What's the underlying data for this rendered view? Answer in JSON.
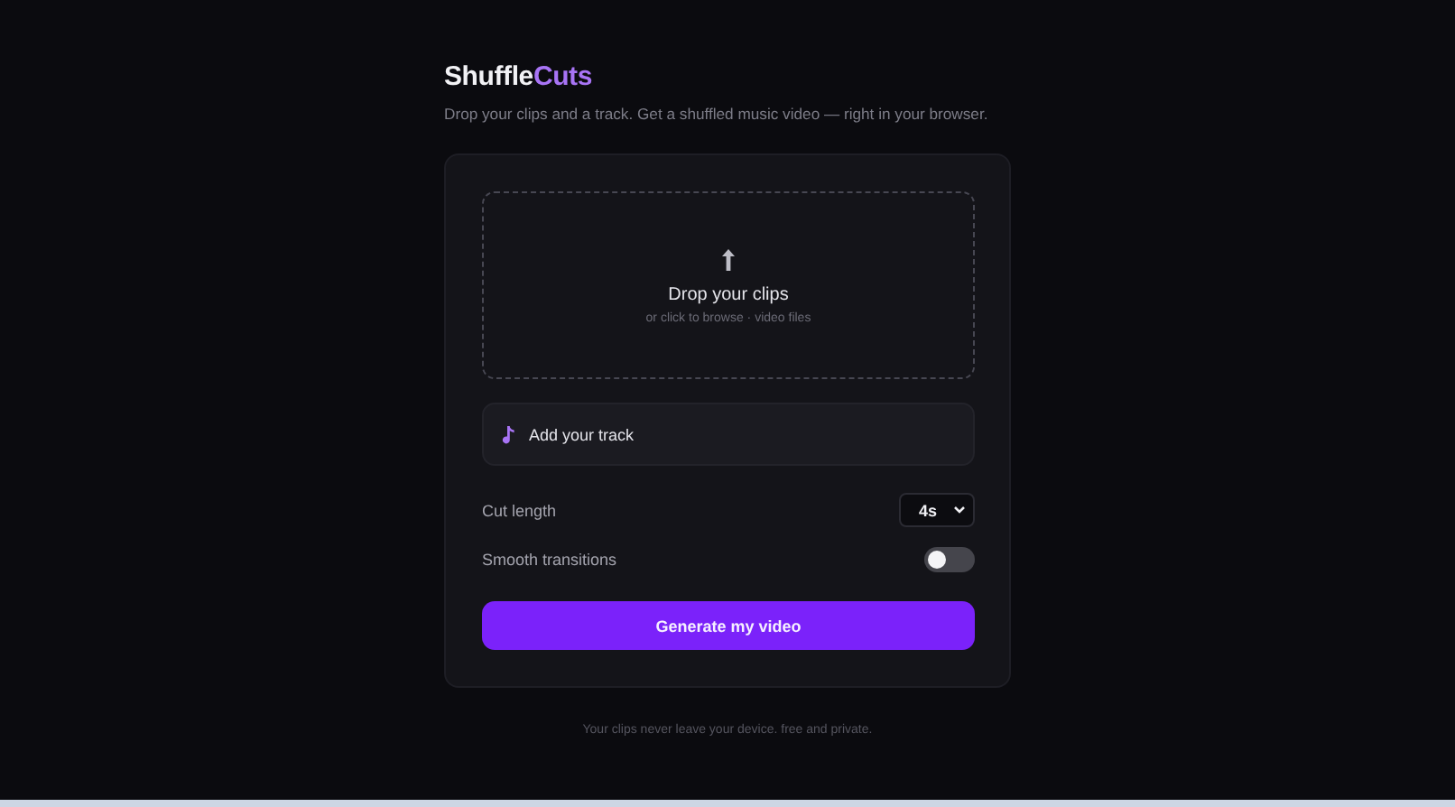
{
  "brand": {
    "name": "Shuffle",
    "accent": "Cuts"
  },
  "tagline": "Drop your clips and a track. Get a shuffled music video — right in your browser.",
  "dropzone": {
    "title": "Drop your clips",
    "hint": "or click to browse · video files"
  },
  "track": {
    "label": "Add your track"
  },
  "settings": [
    {
      "kind": "select",
      "label": "Cut length",
      "value": "4s"
    },
    {
      "kind": "toggle",
      "label": "Smooth transitions",
      "on": false
    }
  ],
  "primary_button": "Generate my video",
  "footer": "Your clips never leave your device. free and private."
}
